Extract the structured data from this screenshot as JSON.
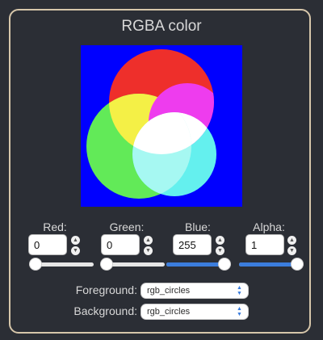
{
  "title": "RGBA color",
  "canvas": {
    "background_color": "#0000ff",
    "image_name": "rgb_circles"
  },
  "channels": [
    {
      "label": "Red:",
      "value": "0",
      "fraction": 0.0
    },
    {
      "label": "Green:",
      "value": "0",
      "fraction": 0.0
    },
    {
      "label": "Blue:",
      "value": "255",
      "fraction": 1.0
    },
    {
      "label": "Alpha:",
      "value": "1",
      "fraction": 1.0
    }
  ],
  "foreground": {
    "label": "Foreground:",
    "value": "rgb_circles"
  },
  "background": {
    "label": "Background:",
    "value": "rgb_circles"
  },
  "colors": {
    "panel_border": "#d6c6aa",
    "slider_fill": "#3b7ddd",
    "bg": "#2b2e35"
  }
}
